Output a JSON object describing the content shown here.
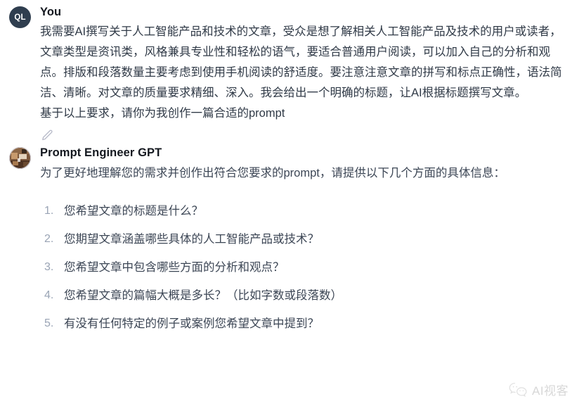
{
  "conversation": {
    "messages": [
      {
        "role": "user",
        "author": "You",
        "avatar_initials": "QL",
        "avatar_color": "#2f3e4f",
        "avatar_text_color": "#ffffff",
        "text": "我需要AI撰写关于人工智能产品和技术的文章，受众是想了解相关人工智能产品及技术的用户或读者，文章类型是资讯类，风格兼具专业性和轻松的语气，要适合普通用户阅读，可以加入自己的分析和观点。排版和段落数量主要考虑到使用手机阅读的舒适度。要注意注意文章的拼写和标点正确性，语法简洁、清晰。对文章的质量要求精细、深入。我会给出一个明确的标题，让AI根据标题撰写文章。",
        "text_second_paragraph": "基于以上要求，请你为我创作一篇合适的prompt",
        "edit_icon": "pencil-icon"
      },
      {
        "role": "assistant",
        "author": "Prompt Engineer GPT",
        "avatar_kind": "photo-avatar",
        "intro": "为了更好地理解您的需求并创作出符合您要求的prompt，请提供以下几个方面的具体信息：",
        "questions": [
          "您希望文章的标题是什么？",
          "您期望文章涵盖哪些具体的人工智能产品或技术？",
          "您希望文章中包含哪些方面的分析和观点？",
          "您希望文章的篇幅大概是多长？（比如字数或段落数）",
          "有没有任何特定的例子或案例您希望文章中提到？"
        ]
      }
    ]
  },
  "watermark": {
    "icon": "wechat-icon",
    "label": "AI视客",
    "color": "#9e9e9e"
  },
  "theme": {
    "background": "#ffffff",
    "body_text": "#3c4655",
    "author_text": "#14181f",
    "list_marker": "#9aa4b5",
    "edit_icon": "#b9bcca"
  }
}
